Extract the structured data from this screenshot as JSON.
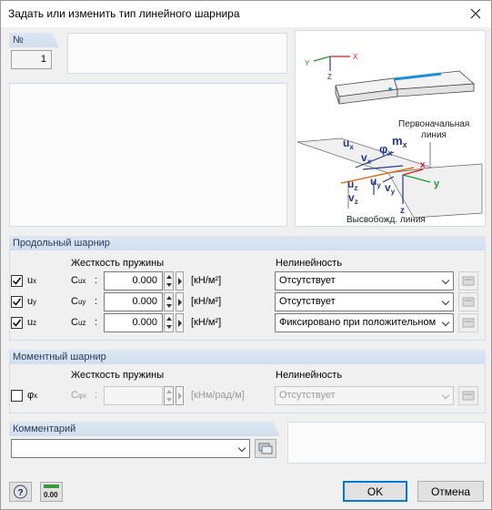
{
  "window": {
    "title": "Задать или изменить тип линейного шарнира"
  },
  "number": {
    "label": "№",
    "value": "1"
  },
  "figure": {
    "label_initial_line": "Первоначальная",
    "label_initial_line_2": "линия",
    "label_released_line": "Высвобожд. линия",
    "axis_x": "X",
    "axis_y": "Y",
    "axis_z": "Z",
    "local_x": "x",
    "local_y": "y",
    "local_z": "z",
    "ux": "u",
    "ux_sub": "x",
    "vx": "v",
    "vx_sub": "x",
    "phix": "φ",
    "phix_sub": "x",
    "mx": "m",
    "mx_sub": "x",
    "uy": "u",
    "uy_sub": "y",
    "vy": "v",
    "vy_sub": "y",
    "uz": "u",
    "uz_sub": "z",
    "vz": "v",
    "vz_sub": "z"
  },
  "longitudinal": {
    "title": "Продольный шарнир",
    "stiffness_header": "Жесткость пружины",
    "nonlinearity_header": "Нелинейность",
    "rows": [
      {
        "checkbox_label": "u",
        "sub": "x",
        "checked": true,
        "coef": "C",
        "coef_sub": "ux",
        "colon": ":",
        "value": "0.000",
        "unit": "[кН/м²]",
        "nonlinearity": "Отсутствует"
      },
      {
        "checkbox_label": "u",
        "sub": "y",
        "checked": true,
        "coef": "C",
        "coef_sub": "uy",
        "colon": ":",
        "value": "0.000",
        "unit": "[кН/м²]",
        "nonlinearity": "Отсутствует"
      },
      {
        "checkbox_label": "u",
        "sub": "z",
        "checked": true,
        "coef": "C",
        "coef_sub": "uz",
        "colon": ":",
        "value": "0.000",
        "unit": "[кН/м²]",
        "nonlinearity": "Фиксировано при положительном"
      }
    ]
  },
  "moment": {
    "title": "Моментный шарнир",
    "stiffness_header": "Жесткость пружины",
    "nonlinearity_header": "Нелинейность",
    "row": {
      "checkbox_label": "φ",
      "sub": "x",
      "checked": false,
      "coef": "C",
      "coef_sub": "φx",
      "colon": ":",
      "value": "",
      "unit": "[кНм/рад/м]",
      "nonlinearity": "Отсутствует"
    }
  },
  "comment": {
    "title": "Комментарий",
    "value": ""
  },
  "buttons": {
    "ok": "OK",
    "cancel": "Отмена",
    "units_icon_text": "0.00"
  },
  "colors": {
    "accent": "#0078d7",
    "header_bg": "#d9e4f1",
    "axis_red": "#e01b1b",
    "axis_green": "#1a9a2a",
    "axis_blue": "#233a8c",
    "hinge_blue": "#1e8fd6",
    "hinge_orange": "#d07a20"
  }
}
